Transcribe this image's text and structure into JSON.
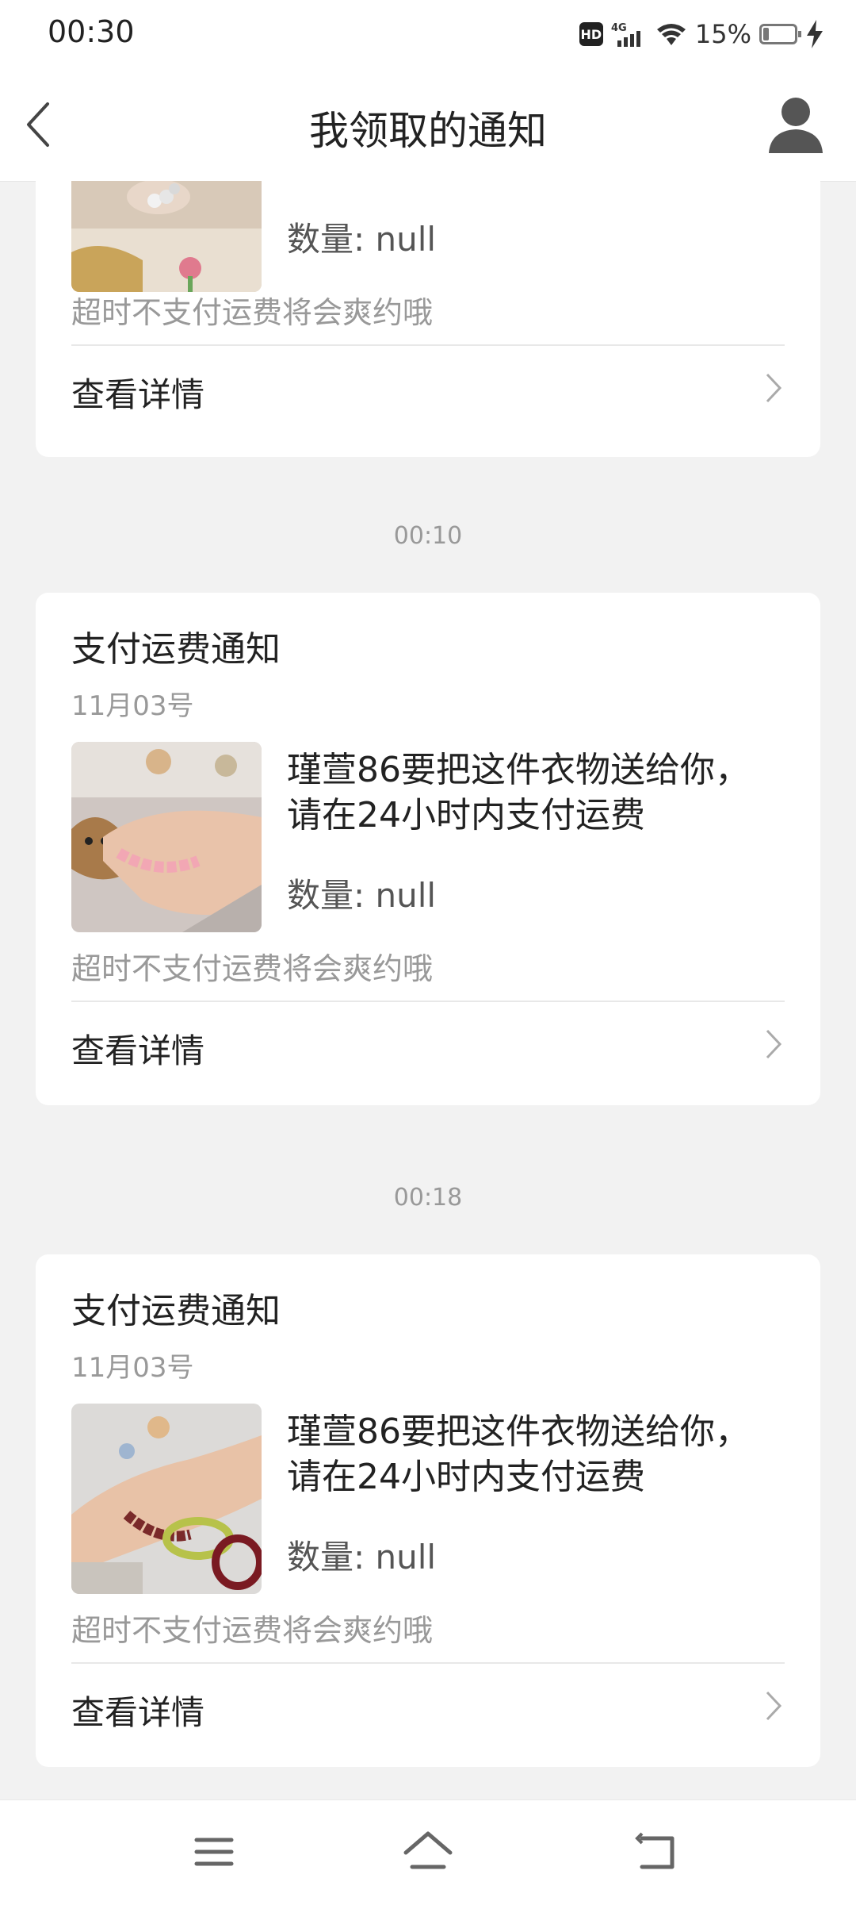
{
  "status_bar": {
    "time": "00:30",
    "hd_label": "HD",
    "network_label": "4G",
    "battery_percent": "15%"
  },
  "header": {
    "title": "我领取的通知"
  },
  "cards": [
    {
      "quantity": "数量: null",
      "warning": "超时不支付运费将会爽约哦",
      "detail_label": "查看详情"
    },
    {
      "timestamp": "00:10",
      "title": "支付运费通知",
      "date": "11月03号",
      "description": "瑾萱86要把这件衣物送给你，请在24小时内支付运费",
      "quantity": "数量: null",
      "warning": "超时不支付运费将会爽约哦",
      "detail_label": "查看详情"
    },
    {
      "timestamp": "00:18",
      "title": "支付运费通知",
      "date": "11月03号",
      "description": "瑾萱86要把这件衣物送给你，请在24小时内支付运费",
      "quantity": "数量: null",
      "warning": "超时不支付运费将会爽约哦",
      "detail_label": "查看详情"
    }
  ],
  "nav": {
    "menu_icon": "menu-icon",
    "home_icon": "home-icon",
    "back_icon": "return-icon"
  }
}
